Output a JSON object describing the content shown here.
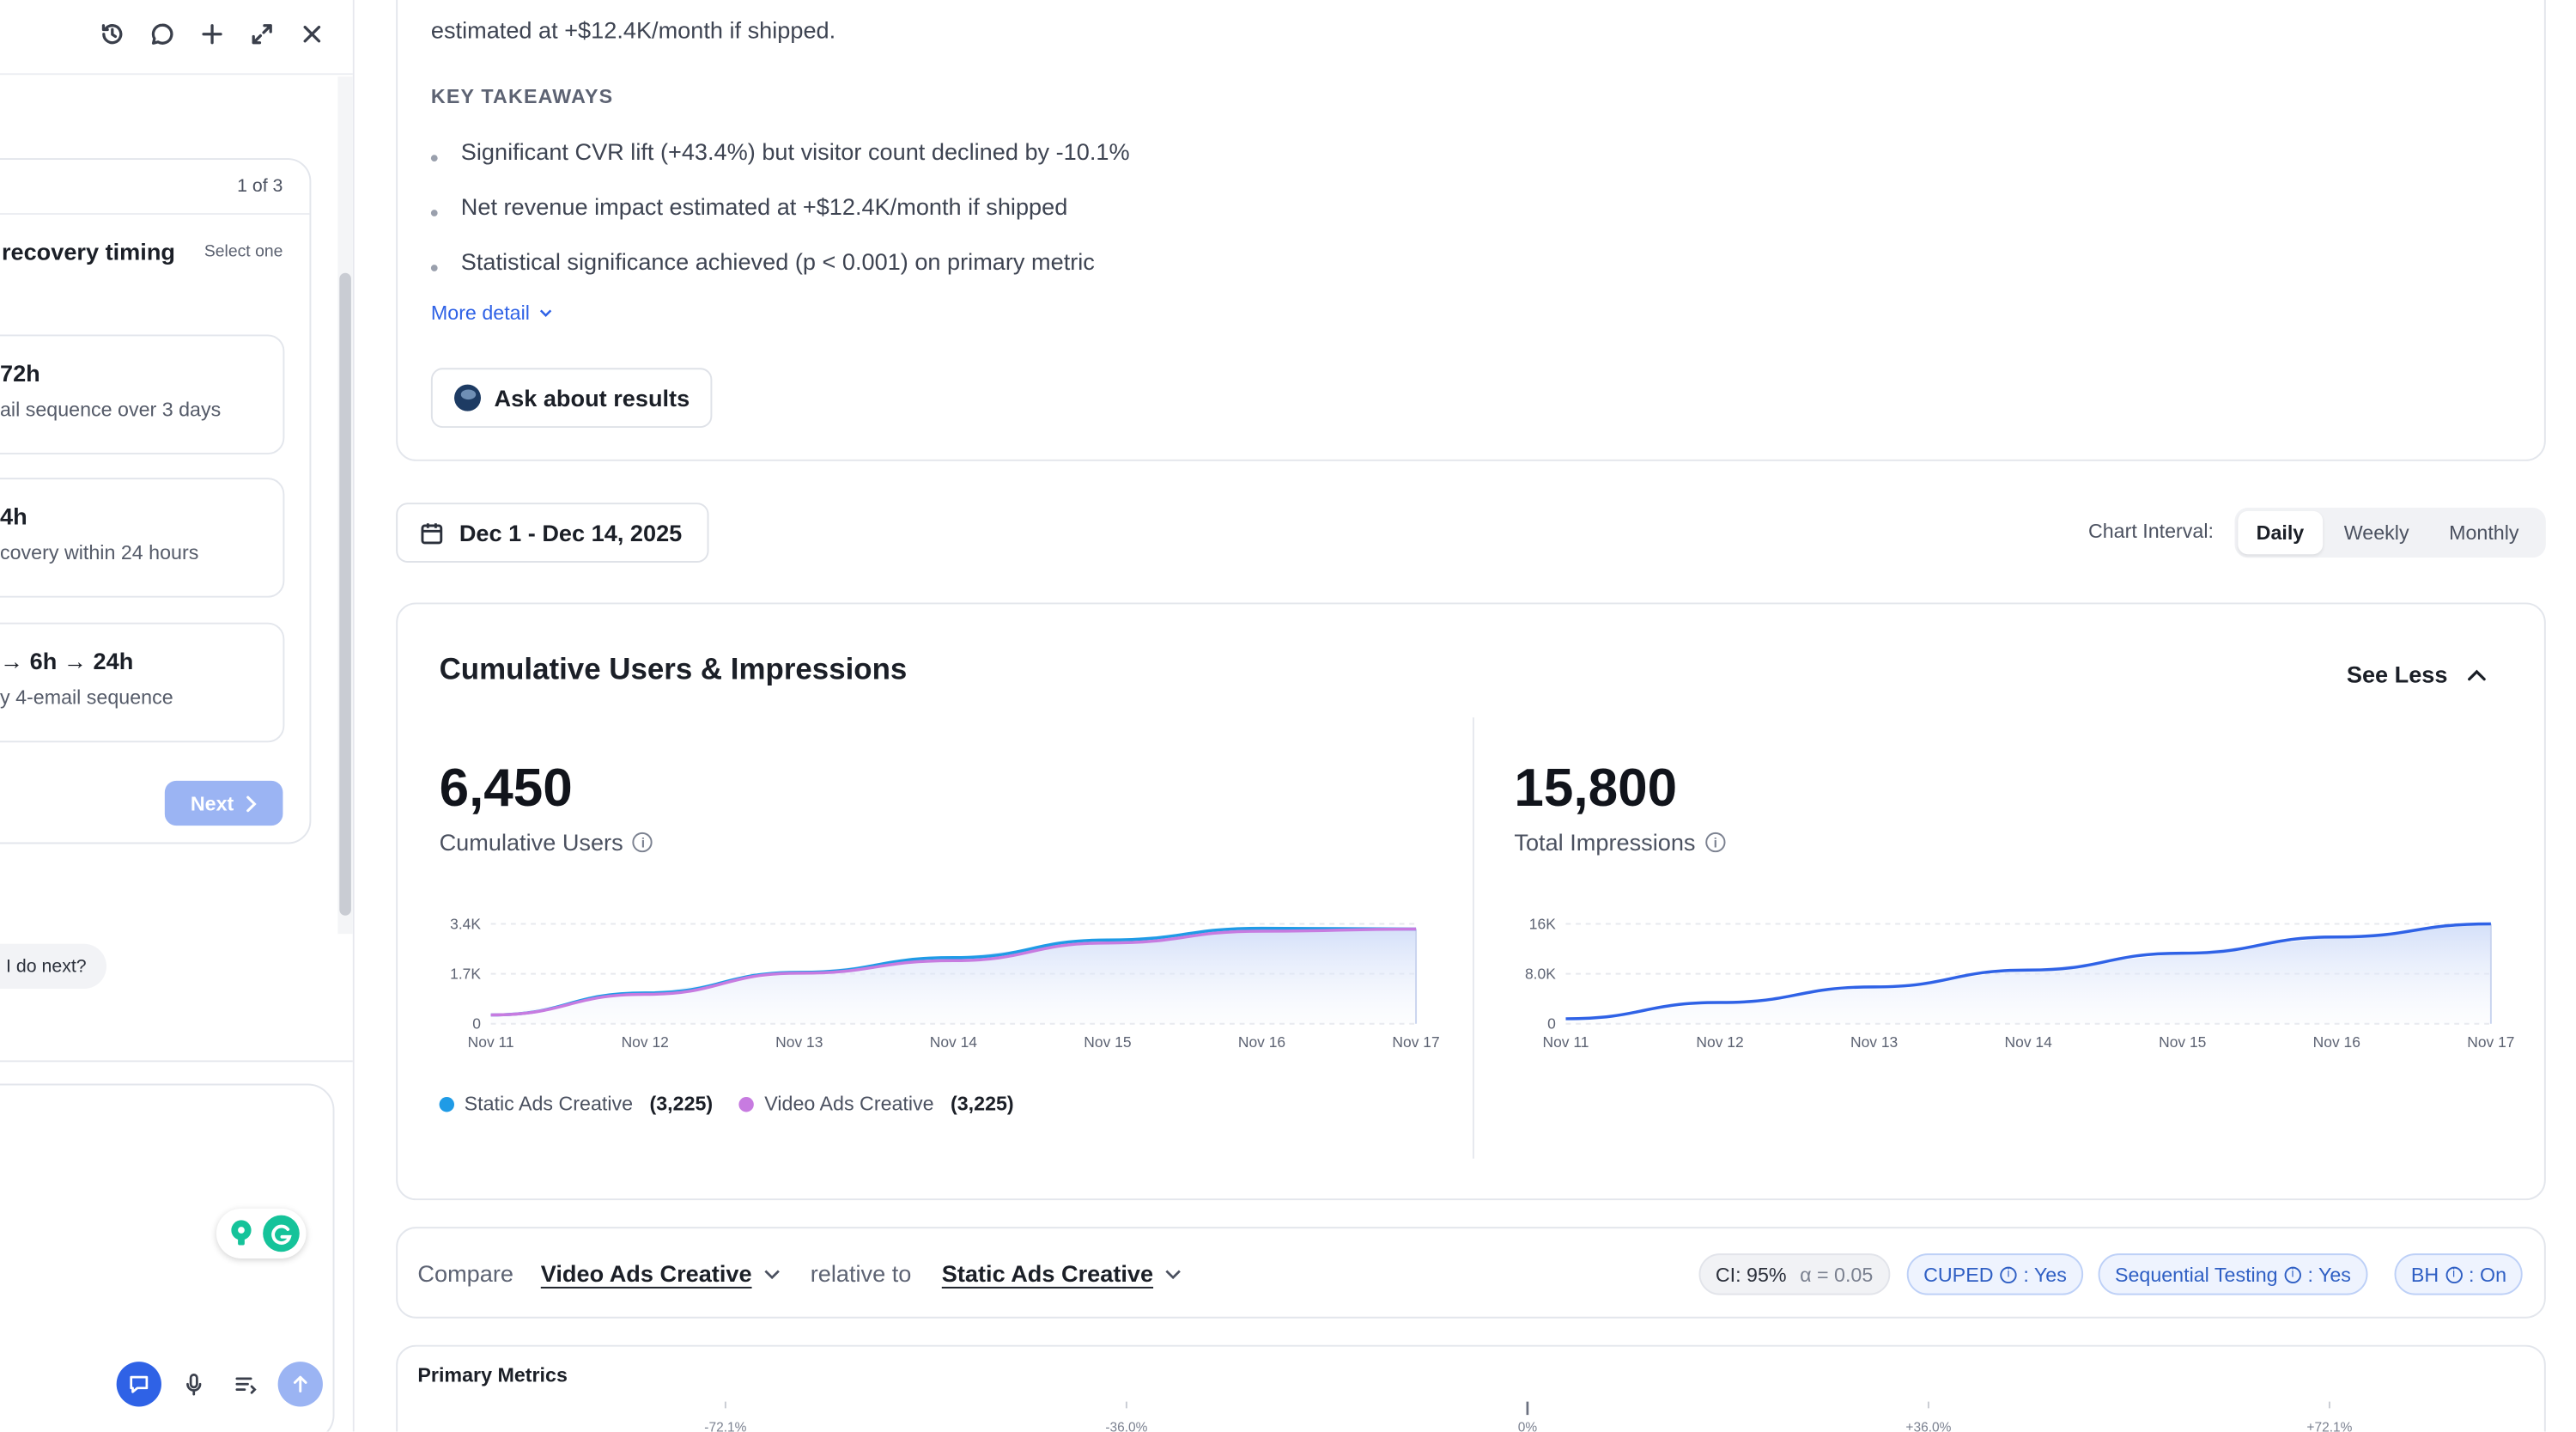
{
  "chat_panel": {
    "toolbar_icons": [
      "history-icon",
      "chat-icon",
      "plus-icon",
      "expand-icon",
      "close-icon"
    ],
    "question": {
      "counter": "1 of 3",
      "title": "recovery timing",
      "hint": "Select one",
      "options": [
        {
          "title": "72h",
          "desc": "ail sequence over 3 days"
        },
        {
          "title": "4h",
          "desc": "covery within 24 hours"
        },
        {
          "title": "→ 6h → 24h",
          "desc": "y 4-email sequence"
        }
      ],
      "next_label": "Next"
    },
    "suggestion": "ld I do next?",
    "composer_tools": [
      "chat-mode-icon",
      "mic-icon",
      "list-icon",
      "send-icon"
    ]
  },
  "summary": {
    "cut_line_top": "",
    "cut_line": "estimated at +$12.4K/month if shipped.",
    "key_takeaways_label": "KEY TAKEAWAYS",
    "takeaways": [
      "Significant CVR lift (+43.4%) but visitor count declined by -10.1%",
      "Net revenue impact estimated at +$12.4K/month if shipped",
      "Statistical significance achieved (p < 0.001) on primary metric"
    ],
    "more_detail": "More detail",
    "ask_button": "Ask about results"
  },
  "controls": {
    "date_range": "Dec 1 - Dec 14, 2025",
    "interval_label": "Chart Interval:",
    "intervals": [
      "Daily",
      "Weekly",
      "Monthly"
    ],
    "active_interval": "Daily"
  },
  "metrics_card": {
    "title": "Cumulative Users & Impressions",
    "see_less": "See Less",
    "users": {
      "value": "6,450",
      "label": "Cumulative Users"
    },
    "impressions": {
      "value": "15,800",
      "label": "Total Impressions"
    },
    "legend": [
      {
        "name": "Static Ads Creative",
        "value": "(3,225)",
        "color": "#1f9be6"
      },
      {
        "name": "Video Ads Creative",
        "value": "(3,225)",
        "color": "#c77be0"
      }
    ]
  },
  "chart_data": [
    {
      "type": "area",
      "x": [
        "Nov 11",
        "Nov 12",
        "Nov 13",
        "Nov 14",
        "Nov 15",
        "Nov 16",
        "Nov 17"
      ],
      "yticks": [
        "0",
        "1.7K",
        "3.4K"
      ],
      "ylim": [
        0,
        3400
      ],
      "series": [
        {
          "name": "Static Ads Creative",
          "color": "#1f9be6",
          "values": [
            300,
            1050,
            1750,
            2250,
            2850,
            3250,
            3225
          ]
        },
        {
          "name": "Video Ads Creative",
          "color": "#c77be0",
          "values": [
            300,
            1000,
            1720,
            2150,
            2750,
            3150,
            3225
          ]
        }
      ],
      "grid": true
    },
    {
      "type": "area",
      "x": [
        "Nov 11",
        "Nov 12",
        "Nov 13",
        "Nov 14",
        "Nov 15",
        "Nov 16",
        "Nov 17"
      ],
      "yticks": [
        "0",
        "8.0K",
        "16K"
      ],
      "ylim": [
        0,
        16000
      ],
      "series": [
        {
          "color": "#2f62e6",
          "values": [
            800,
            3400,
            5900,
            8600,
            11300,
            13900,
            16000
          ]
        }
      ],
      "grid": true
    }
  ],
  "compare": {
    "compare_label": "Compare",
    "variant": "Video Ads Creative",
    "relative_label": "relative to",
    "baseline": "Static Ads Creative",
    "ci": "CI: 95%",
    "alpha": "α = 0.05",
    "cuped": "CUPED",
    "cuped_val": ": Yes",
    "seq": "Sequential Testing",
    "seq_val": ": Yes",
    "bh": "BH",
    "bh_val": ": On"
  },
  "primary_metrics": {
    "title": "Primary Metrics",
    "axis_ticks": [
      "-72.1%",
      "-36.0%",
      "0%",
      "+36.0%",
      "+72.1%"
    ]
  }
}
